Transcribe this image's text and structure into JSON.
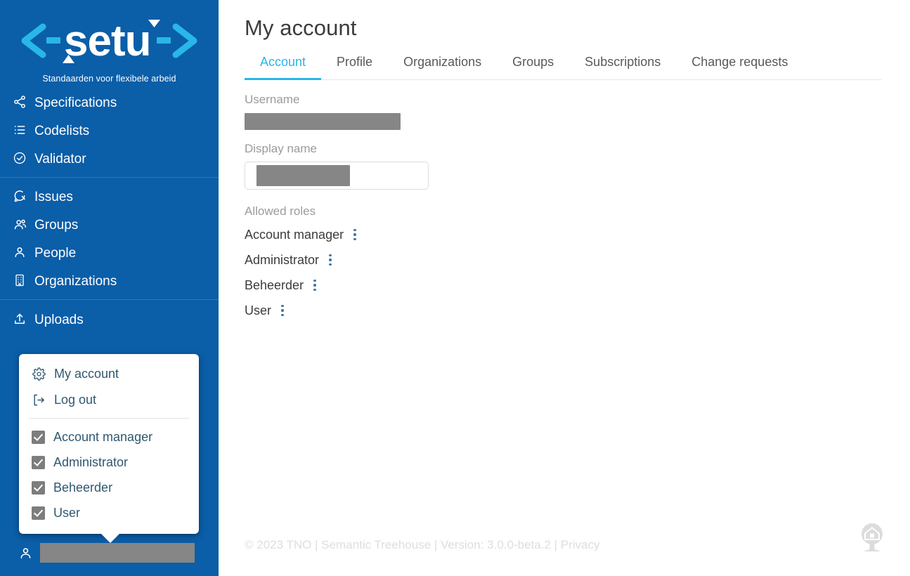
{
  "brand": {
    "logo_text": "setu",
    "logo_left_arrow": "<-",
    "logo_right_arrow": "->",
    "tagline": "Standaarden voor flexibele arbeid",
    "sidebar_color": "#0b5ea8",
    "accent_color": "#29b6e8"
  },
  "sidebar": {
    "groups": [
      {
        "items": [
          {
            "label": "Specifications",
            "icon": "share-nodes-icon"
          },
          {
            "label": "Codelists",
            "icon": "list-icon"
          },
          {
            "label": "Validator",
            "icon": "check-badge-icon"
          }
        ]
      },
      {
        "items": [
          {
            "label": "Issues",
            "icon": "comment-icon"
          },
          {
            "label": "Groups",
            "icon": "people-group-icon"
          },
          {
            "label": "People",
            "icon": "person-icon"
          },
          {
            "label": "Organizations",
            "icon": "building-icon"
          }
        ]
      },
      {
        "items": [
          {
            "label": "Uploads",
            "icon": "upload-icon"
          }
        ]
      }
    ],
    "user": {
      "icon": "person-icon",
      "name_redacted": true
    }
  },
  "account_popup": {
    "items": [
      {
        "label": "My account",
        "icon": "gear-icon"
      },
      {
        "label": "Log out",
        "icon": "logout-icon"
      }
    ],
    "roles": [
      {
        "label": "Account manager",
        "checked": true
      },
      {
        "label": "Administrator",
        "checked": true
      },
      {
        "label": "Beheerder",
        "checked": true
      },
      {
        "label": "User",
        "checked": true
      }
    ]
  },
  "main": {
    "title": "My account",
    "tabs": [
      {
        "label": "Account",
        "active": true
      },
      {
        "label": "Profile",
        "active": false
      },
      {
        "label": "Organizations",
        "active": false
      },
      {
        "label": "Groups",
        "active": false
      },
      {
        "label": "Subscriptions",
        "active": false
      },
      {
        "label": "Change requests",
        "active": false
      }
    ],
    "fields": {
      "username_label": "Username",
      "username_value": "",
      "username_redacted": true,
      "display_name_label": "Display name",
      "display_name_value": "",
      "display_name_placeholder": "",
      "display_name_redacted": true
    },
    "allowed_roles": {
      "label": "Allowed roles",
      "items": [
        {
          "label": "Account manager",
          "menu_icon": "kebab-menu-icon"
        },
        {
          "label": "Administrator",
          "menu_icon": "kebab-menu-icon"
        },
        {
          "label": "Beheerder",
          "menu_icon": "kebab-menu-icon"
        },
        {
          "label": "User",
          "menu_icon": "kebab-menu-icon"
        }
      ]
    }
  },
  "footer": {
    "copyright": "© 2023 TNO",
    "product": "Semantic Treehouse",
    "version": "Version: 3.0.0-beta.2",
    "privacy": "Privacy",
    "separator": " | ",
    "full_text": "© 2023 TNO | Semantic Treehouse | Version: 3.0.0-beta.2 | Privacy",
    "logo_icon": "treehouse-logo-icon"
  }
}
